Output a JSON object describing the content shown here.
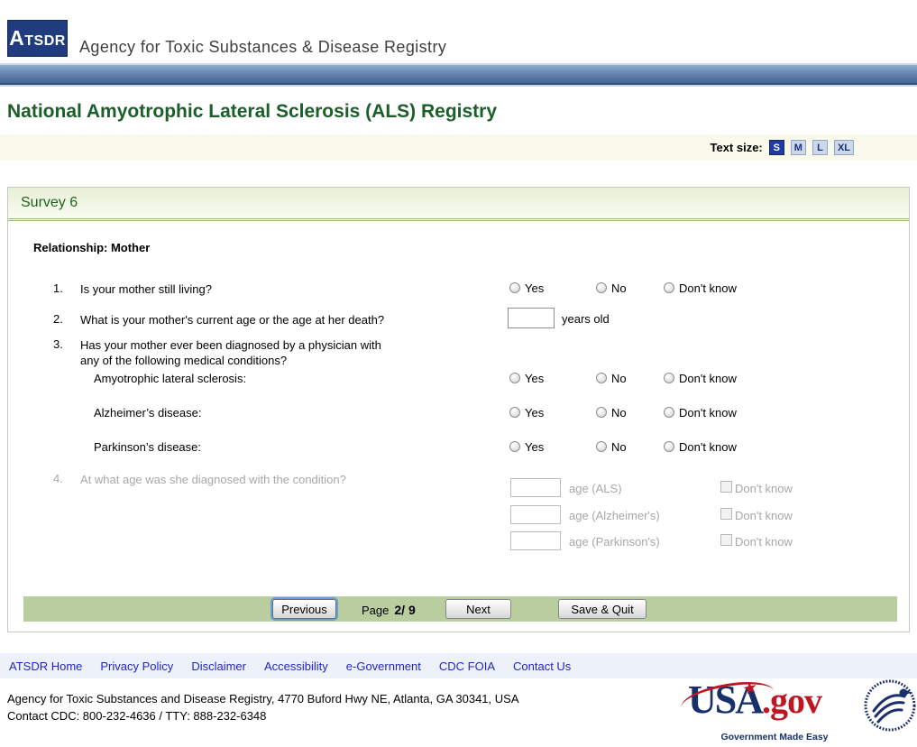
{
  "header": {
    "logo_text": "ATSDR",
    "agency_name": "Agency for Toxic Substances & Disease Registry"
  },
  "page_title": "National Amyotrophic Lateral Sclerosis (ALS) Registry",
  "text_size": {
    "label": "Text size:",
    "options": [
      "S",
      "M",
      "L",
      "XL"
    ],
    "selected": "S"
  },
  "survey": {
    "title": "Survey 6",
    "relationship_label": "Relationship: Mother",
    "radio_options": [
      "Yes",
      "No",
      "Don't know"
    ],
    "q1": {
      "number": "1.",
      "text": "Is your mother still living?"
    },
    "q2": {
      "number": "2.",
      "text": "What is your mother's current age or the age at her death?",
      "input_suffix": "years old"
    },
    "q3": {
      "number": "3.",
      "text_line1": "Has your mother ever been diagnosed by a physician with",
      "text_line2": "any of the following medical conditions?"
    },
    "conditions": [
      "Amyotrophic lateral sclerosis:",
      "Alzheimer’s disease:",
      "Parkinson’s disease:"
    ],
    "q4": {
      "number": "4.",
      "text": "At what age was she diagnosed with the condition?"
    },
    "age_rows": [
      {
        "label": "age (ALS)",
        "checkbox_label": "Don't know"
      },
      {
        "label": "age (Alzheimer's)",
        "checkbox_label": "Don't know"
      },
      {
        "label": "age (Parkinson's)",
        "checkbox_label": "Don't know"
      }
    ],
    "nav": {
      "previous": "Previous",
      "page_label": "Page",
      "page_value": "2/ 9",
      "next": "Next",
      "save_quit": "Save & Quit"
    }
  },
  "footer": {
    "links": [
      "ATSDR Home",
      "Privacy Policy",
      "Disclaimer",
      "Accessibility",
      "e-Government",
      "CDC FOIA",
      "Contact Us"
    ],
    "address": "Agency for Toxic Substances and Disease Registry, 4770 Buford Hwy NE, Atlanta, GA 30341, USA",
    "contact": "Contact CDC: 800-232-4636 / TTY: 888-232-6348",
    "usa_gov": {
      "usa": "USA",
      "dot_gov": ".gov",
      "tagline": "Government Made Easy",
      "star_icon": "★"
    }
  },
  "colors": {
    "header_navy": "#203c7e",
    "blue_bar": "#52739f",
    "title_green": "#1b5e29",
    "panel_header_green": "#e7efd6",
    "nav_green": "#b9cd9f",
    "link_blue": "#2425c8",
    "disabled_gray": "#a7a7a7",
    "usagov_navy": "#17306b",
    "usagov_red": "#bf1722"
  }
}
